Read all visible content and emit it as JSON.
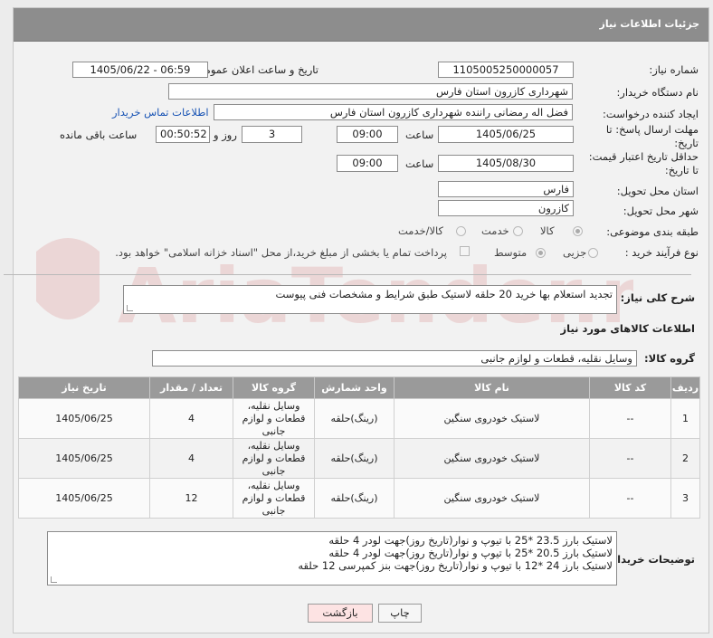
{
  "header": {
    "title": "جزئیات اطلاعات نیاز"
  },
  "need_number": {
    "label": "شماره نیاز:",
    "value": "1105005250000057"
  },
  "announce": {
    "label": "تاریخ و ساعت اعلان عمومی:",
    "value": "1405/06/22 - 06:59"
  },
  "buyer_org": {
    "label": "نام دستگاه خریدار:",
    "value": "شهرداری کازرون استان فارس"
  },
  "requester": {
    "label": "ایجاد کننده درخواست:",
    "value": "فضل اله رمضانی راننده شهرداری کازرون استان فارس",
    "contact_link": "اطلاعات تماس خریدار"
  },
  "deadline": {
    "label_line1": "مهلت ارسال پاسخ: تا",
    "label_line2": "تاریخ:",
    "date": "1405/06/25",
    "time_label": "ساعت",
    "time": "09:00",
    "days": "3",
    "days_label": "روز و",
    "remaining": "00:50:52",
    "remaining_label": "ساعت باقی مانده"
  },
  "validity": {
    "label_line1": "حداقل تاریخ اعتبار قیمت:",
    "label_line2": "تا تاریخ:",
    "date": "1405/08/30",
    "time_label": "ساعت",
    "time": "09:00"
  },
  "province": {
    "label": "استان محل تحویل:",
    "value": "فارس"
  },
  "city": {
    "label": "شهر محل تحویل:",
    "value": "کازرون"
  },
  "category": {
    "label": "طبقه بندی موضوعی:",
    "options": [
      "کالا",
      "خدمت",
      "کالا/خدمت"
    ],
    "selected": "کالا"
  },
  "process": {
    "label": "نوع فرآیند خرید :",
    "options": [
      "جزیی",
      "متوسط"
    ],
    "selected": "متوسط",
    "treasury_note": "پرداخت تمام یا بخشی از مبلغ خرید،از محل \"اسناد خزانه اسلامی\" خواهد بود."
  },
  "summary": {
    "label": "شرح کلی نیاز:",
    "value": "تجدید استعلام بها خرید 20 حلقه لاستیک طبق شرایط و مشخصات فنی پیوست"
  },
  "goods_section": {
    "title": "اطلاعات کالاهای مورد نیاز",
    "group_label": "گروه کالا:",
    "group_value": "وسایل نقلیه، قطعات و لوازم جانبی"
  },
  "table": {
    "headers": [
      "ردیف",
      "کد کالا",
      "نام کالا",
      "واحد شمارش",
      "گروه کالا",
      "تعداد / مقدار",
      "تاریخ نیاز"
    ],
    "rows": [
      [
        "1",
        "--",
        "لاستیک خودروی سنگین",
        "(رینگ)حلقه",
        "وسایل نقلیه، قطعات و لوازم جانبی",
        "4",
        "1405/06/25"
      ],
      [
        "2",
        "--",
        "لاستیک خودروی سنگین",
        "(رینگ)حلقه",
        "وسایل نقلیه، قطعات و لوازم جانبی",
        "4",
        "1405/06/25"
      ],
      [
        "3",
        "--",
        "لاستیک خودروی سنگین",
        "(رینگ)حلقه",
        "وسایل نقلیه، قطعات و لوازم جانبی",
        "12",
        "1405/06/25"
      ]
    ]
  },
  "buyer_notes": {
    "label": "توضیحات خریدار:",
    "lines": [
      "لاستیک بارز 23.5 *25 با تیوپ و نوار(تاریخ روز)جهت لودر 4 حلقه",
      "لاستیک بارز 20.5 *25 با تیوپ و نوار(تاریخ روز)جهت لودر 4 حلقه",
      "لاستیک بارز 24 *12 با تیوپ و نوار(تاریخ روز)جهت بنز کمپرسی 12 حلقه"
    ]
  },
  "buttons": {
    "print": "چاپ",
    "back": "بازگشت"
  },
  "watermark": {
    "text": "AriaTender.neT"
  },
  "colors": {
    "header_bg": "#8d8d8d",
    "link": "#1a55b5",
    "back_button_bg": "#fde3e3"
  }
}
